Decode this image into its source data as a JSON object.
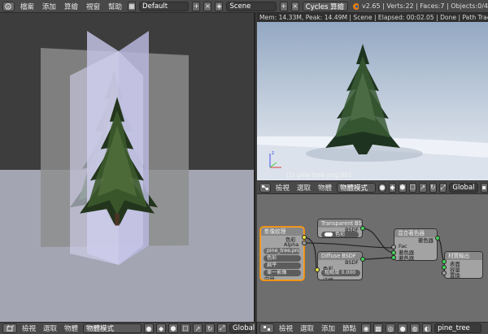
{
  "menu": {
    "items": [
      "檔案",
      "添加",
      "算繪",
      "視窗",
      "幫助"
    ],
    "layout_value": "Default",
    "scene_value": "Scene",
    "engine_value": "Cycles 算繪",
    "stats": "v2.65 | Verts:22 | Faces:7 | Objects:0/4"
  },
  "render": {
    "info": "Mem: 14.33M, Peak: 14.49M | Scene | Elapsed: 00:02.05 | Done | Path Tracing Sample 10/10",
    "object_label": "(1) pine tree.png.001"
  },
  "node_header": {
    "items": [
      "檢視",
      "選取",
      "物體"
    ],
    "mode_value": "物體模式",
    "orientation_value": "Global"
  },
  "nodes": {
    "image_texture": {
      "title": "影像紋理",
      "outputs": [
        "色彩",
        "Alpha"
      ],
      "image_name": "pine_tree.png",
      "color_mode": "色彩",
      "projection": "扁平",
      "source": "單一影像",
      "vector_label": "向量"
    },
    "transparent": {
      "title": "Transparent BS",
      "output": "BSDF",
      "input": "色彩"
    },
    "diffuse": {
      "title": "Diffuse BSDF",
      "output": "BSDF",
      "input_color": "色彩",
      "roughness": "粗糙度 0.000",
      "normal": "法線"
    },
    "mix": {
      "title": "混合著色器",
      "output": "著色器",
      "fac": "Fac",
      "shader1": "著色器",
      "shader2": "著色器"
    },
    "output": {
      "title": "材質輸出",
      "surface": "表面",
      "volume": "容量",
      "displacement": "置換"
    }
  },
  "bottom_left": {
    "items": [
      "檢視",
      "選取",
      "物體"
    ],
    "mode_value": "物體模式",
    "orientation_value": "Global"
  },
  "bottom_right": {
    "items": [
      "檢視",
      "選取",
      "添加",
      "節點"
    ],
    "material_value": "pine_tree"
  },
  "colors": {
    "accent_selected": "#ffa020",
    "socket_shader": "#45d05a",
    "socket_color": "#e5e540"
  }
}
